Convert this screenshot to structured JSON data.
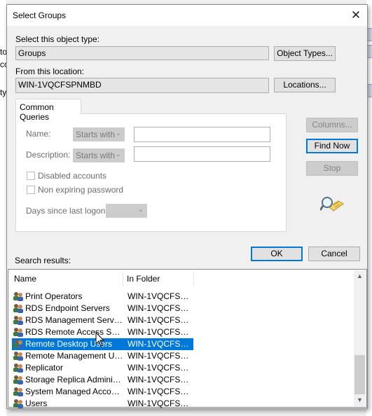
{
  "background": {
    "fragments": [
      "to",
      "co",
      "ty"
    ]
  },
  "dialog": {
    "title": "Select Groups",
    "close_glyph": "✕",
    "object_type_label": "Select this object type:",
    "object_type_value": "Groups",
    "object_types_button": "Object Types...",
    "location_label": "From this location:",
    "location_value": "WIN-1VQCFSPNMBD",
    "locations_button": "Locations..."
  },
  "common_queries": {
    "tab_label": "Common Queries",
    "name_label": "Name:",
    "name_mode": "Starts with",
    "description_label": "Description:",
    "description_mode": "Starts with",
    "disabled_accounts_label": "Disabled accounts",
    "non_expiring_label": "Non expiring password",
    "days_label": "Days since last logon:"
  },
  "buttons": {
    "columns": "Columns...",
    "find_now": "Find Now",
    "stop": "Stop",
    "ok": "OK",
    "cancel": "Cancel"
  },
  "results": {
    "label": "Search results:",
    "columns": [
      "Name",
      "In Folder"
    ],
    "rows": [
      {
        "name": "Print Operators",
        "folder": "WIN-1VQCFSP...",
        "selected": false
      },
      {
        "name": "RDS Endpoint Servers",
        "folder": "WIN-1VQCFSP...",
        "selected": false
      },
      {
        "name": "RDS Management Servers",
        "folder": "WIN-1VQCFSP...",
        "selected": false
      },
      {
        "name": "RDS Remote Access Serv...",
        "folder": "WIN-1VQCFSP...",
        "selected": false
      },
      {
        "name": "Remote Desktop Users",
        "folder": "WIN-1VQCFSP...",
        "selected": true
      },
      {
        "name": "Remote Management Users",
        "folder": "WIN-1VQCFSP...",
        "selected": false
      },
      {
        "name": "Replicator",
        "folder": "WIN-1VQCFSP...",
        "selected": false
      },
      {
        "name": "Storage Replica Administra...",
        "folder": "WIN-1VQCFSP...",
        "selected": false
      },
      {
        "name": "System Managed Account...",
        "folder": "WIN-1VQCFSP...",
        "selected": false
      },
      {
        "name": "Users",
        "folder": "WIN-1VQCFSP...",
        "selected": false
      }
    ]
  },
  "colors": {
    "selection": "#0078d7",
    "default_button_border": "#0078d7"
  },
  "icons": {
    "row_icon": "group-icon",
    "search_icon": "search-magnifier-icon",
    "close_icon": "close-icon"
  }
}
